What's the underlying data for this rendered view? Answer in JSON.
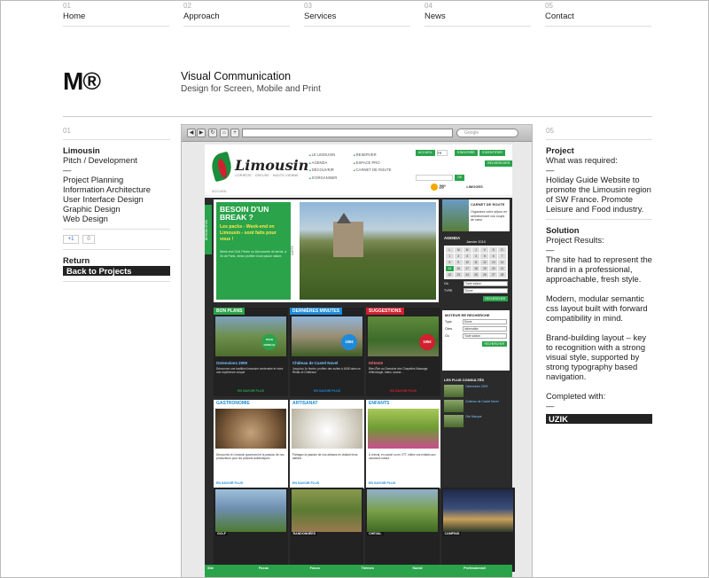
{
  "nav": [
    {
      "num": "01",
      "label": "Home"
    },
    {
      "num": "02",
      "label": "Approach"
    },
    {
      "num": "03",
      "label": "Services"
    },
    {
      "num": "04",
      "label": "News"
    },
    {
      "num": "05",
      "label": "Contact"
    }
  ],
  "header": {
    "logo": "M®",
    "title": "Visual Communication",
    "subtitle": "Design for Screen, Mobile and Print"
  },
  "left": {
    "num": "01",
    "project_name": "Limousin",
    "project_type": "Pitch / Development",
    "dash": "—",
    "services": [
      "Project Planning",
      "Information Architecture",
      "User Interface Design",
      "Graphic Design",
      "Web Design"
    ],
    "share_gplus": "+1",
    "share_count": "0",
    "return_label": "Return",
    "back_label": "Back to Projects"
  },
  "right": {
    "num": "05",
    "project_heading": "Project",
    "required_label": "What was required:",
    "dash": "—",
    "required_text": "Holiday Guide Website to promote the Limousin region of SW France. Promote Leisure and Food industry.",
    "solution_heading": "Solution",
    "results_label": "Project Results:",
    "result_1": "The site had to represent the brand in a professional, approachable, fresh style.",
    "result_2": "Modern, modular semantic css layout built with forward compatibility in mind.",
    "result_3": "Brand-building layout – key to recognition with a strong visual style, supported by strong typography based navigation.",
    "completed_label": "Completed with:",
    "completed_with": "UZIK"
  },
  "shot": {
    "browser_search": "Google",
    "site": {
      "logo_word": "Limousin",
      "logo_sub": "CORRÈZE · CREUSE · HAUTE-VIENNE",
      "accueil": "ACCUEIL",
      "menu1": [
        "LE LIMOUSIN",
        "AGENDA",
        "DÉCOUVRIR",
        "S'ORGANISER"
      ],
      "menu2": [
        "RESERVER",
        "ESPACE PRO",
        "CARNET DE ROUTE"
      ],
      "lang_btn": "ACCUEIL",
      "lang_code": "FR",
      "signup": "S'INSCRIRE",
      "identify": "S'IDENTIFIER",
      "search_btn": "RECHERCHER",
      "newsletter_btn": "OK",
      "weather_temp": "28°",
      "weather_city": "LIMOGES",
      "sidetab": "BESOIN D'UN",
      "hero_title": "BESOIN D'UN BREAK ?",
      "hero_sub": "Les packs - Week-end en Limousin - sont faits pour vous !",
      "hero_desc": "Week-end Golf, Pêche ou Découverte du terroir, à 3h de Paris, venez profiter d'une pause nature.",
      "carte": "CARTE",
      "carnet_title": "CARNET DE ROUTE",
      "carnet_desc": "Organisez votre séjour en sélectionnant vos coups de cœur",
      "agenda_title": "AGENDA",
      "agenda_month": "Janvier 2010",
      "cal_days": [
        "L",
        "M",
        "M",
        "J",
        "V",
        "S",
        "D",
        "1",
        "2",
        "3",
        "4",
        "5",
        "6",
        "7",
        "8",
        "9",
        "10",
        "11",
        "12",
        "13",
        "14",
        "15",
        "16",
        "17",
        "18",
        "19",
        "20",
        "21",
        "22",
        "23",
        "24",
        "25",
        "26",
        "27",
        "28"
      ],
      "form_ou": "Où",
      "form_type": "TYPE",
      "form_sel1": "Toute saison",
      "form_sel2": "Dome",
      "moteur_title": "MOTEUR RE RECHERCHE",
      "moteur_type": "Type",
      "moteur_type_val": "Dome",
      "moteur_cites": "Cites",
      "moteur_cites_val": "Information",
      "moteur_ou": "Ou",
      "moteur_ou_val": "Toute saison",
      "plus_title": "LES PLUS CONSULTÉS",
      "plus_items": [
        "Ostensions 2009",
        "Château de Castel Novel",
        "Cité Marque"
      ],
      "more": "EN SAVOIR PLUS",
      "row1": [
        {
          "tag": "BON PLANS",
          "title": "Ostensions 2009",
          "badge": "PACK FAMILLE",
          "desc": "Découvrez une tradition limousine centenaire et vivez une expérience unique"
        },
        {
          "tag": "DERNIÈRES MINUTES",
          "title": "Château de Castel Novel",
          "badge": "195€",
          "desc": "Jusqu'au 1e février, profitez des suites à 160€ dans ce Relais et Châteaux"
        },
        {
          "tag": "SUGGESTIONS",
          "title": "Détente",
          "badge": "195€",
          "desc": "Bien-Être au Domaine des Chapelles Massage, réflexologie, bains, sauna..."
        }
      ],
      "row2": [
        {
          "tag": "GASTRONOMIE",
          "desc": "Découvrez le Limousin gourmand et la passion de nos producteurs pour les produits authentiques"
        },
        {
          "tag": "ARTISANAT",
          "desc": "Partagez la passion de nos artisans en visitant leurs ateliers"
        },
        {
          "tag": "ENFANTS",
          "desc": "À cheval, en canoë ou en VTT, initiez vos enfants aux vacances nature"
        }
      ],
      "row3": [
        {
          "label": "GOLF"
        },
        {
          "label": "RANDONNÉES"
        },
        {
          "label": "CHEVAL"
        },
        {
          "label": "CAMPING"
        }
      ],
      "footer": [
        "Site",
        "Focus",
        "Focus",
        "Thèmes",
        "Social",
        "Professionnel"
      ]
    }
  },
  "colors": {
    "green": "#2aa34a",
    "blue_tag": "#1e8bd8",
    "red_tag": "#d2202f",
    "dark": "#222222"
  }
}
